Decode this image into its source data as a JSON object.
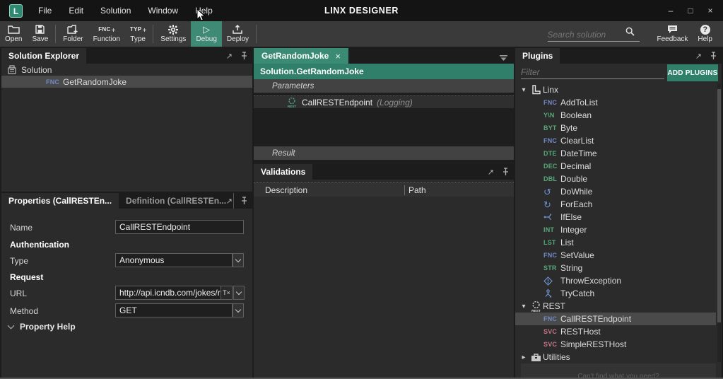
{
  "icons": {
    "caret_down": "▾",
    "caret_right": "▸",
    "popout": "↗",
    "close": "×",
    "minimize": "–",
    "maximize": "□",
    "play": "▷",
    "plus": "+",
    "loop_ccw": "↺",
    "loop_cw": "↻"
  },
  "colors": {
    "accent_teal": "#2f8069",
    "tab_teal": "#3b8a74",
    "badge_blue": "#7189c7",
    "badge_green": "#57a878",
    "badge_pink": "#c57487",
    "icon_blue": "#6b92cf"
  },
  "titlebar": {
    "logo_letter": "L",
    "app_title": "LINX DESIGNER",
    "menus": [
      {
        "label": "File"
      },
      {
        "label": "Edit"
      },
      {
        "label": "Solution"
      },
      {
        "label": "Window"
      },
      {
        "label": "Help"
      }
    ]
  },
  "toolbar": {
    "buttons": [
      {
        "label": "Open"
      },
      {
        "label": "Save"
      },
      {
        "label": "Folder"
      },
      {
        "label": "Function",
        "icon_text": "FNC"
      },
      {
        "label": "Type",
        "icon_text": "TYP"
      },
      {
        "label": "Settings"
      },
      {
        "label": "Debug"
      },
      {
        "label": "Deploy"
      }
    ],
    "search_placeholder": "Search solution",
    "feedback_label": "Feedback",
    "help_label": "Help"
  },
  "solution_explorer": {
    "title": "Solution Explorer",
    "root_label": "Solution",
    "items": [
      {
        "badge": "FNC",
        "label": "GetRandomJoke"
      }
    ]
  },
  "properties": {
    "tab_properties": "Properties (CallRESTEn...",
    "tab_definition": "Definition (CallRESTEn...",
    "name_label": "Name",
    "name_value": "CallRESTEndpoint",
    "auth_section": "Authentication",
    "type_label": "Type",
    "type_value": "Anonymous",
    "request_section": "Request",
    "url_label": "URL",
    "url_value": "http://api.icndb.com/jokes/ran",
    "url_clear": "T×",
    "method_label": "Method",
    "method_value": "GET",
    "property_help_label": "Property Help"
  },
  "editor": {
    "tab_label": "GetRandomJoke",
    "breadcrumb": "Solution.GetRandomJoke",
    "parameters_label": "Parameters",
    "function_name": "CallRESTEndpoint",
    "function_suffix": "(Logging)",
    "function_icon_text": "REST",
    "result_label": "Result"
  },
  "validations": {
    "title": "Validations",
    "columns": [
      {
        "label": "Description"
      },
      {
        "label": "Path"
      }
    ]
  },
  "plugins": {
    "title": "Plugins",
    "filter_placeholder": "Filter",
    "add_button": "ADD PLUGINS",
    "footer": "Can't find what you need?",
    "rest_icon_text": "REST",
    "tree": [
      {
        "type": "group",
        "label": "Linx",
        "expanded": true
      },
      {
        "type": "item",
        "badge": "FNC",
        "badge_color": "blue",
        "label": "AddToList"
      },
      {
        "type": "item",
        "badge": "Y\\N",
        "badge_color": "green",
        "label": "Boolean"
      },
      {
        "type": "item",
        "badge": "BYT",
        "badge_color": "green",
        "label": "Byte"
      },
      {
        "type": "item",
        "badge": "FNC",
        "badge_color": "blue",
        "label": "ClearList"
      },
      {
        "type": "item",
        "badge": "DTE",
        "badge_color": "green",
        "label": "DateTime"
      },
      {
        "type": "item",
        "badge": "DEC",
        "badge_color": "green",
        "label": "Decimal"
      },
      {
        "type": "item",
        "badge": "DBL",
        "badge_color": "green",
        "label": "Double"
      },
      {
        "type": "item",
        "icon": "dowhile",
        "label": "DoWhile"
      },
      {
        "type": "item",
        "icon": "foreach",
        "label": "ForEach"
      },
      {
        "type": "item",
        "icon": "ifelse",
        "label": "IfElse"
      },
      {
        "type": "item",
        "badge": "INT",
        "badge_color": "green",
        "label": "Integer"
      },
      {
        "type": "item",
        "badge": "LST",
        "badge_color": "green",
        "label": "List"
      },
      {
        "type": "item",
        "badge": "FNC",
        "badge_color": "blue",
        "label": "SetValue"
      },
      {
        "type": "item",
        "badge": "STR",
        "badge_color": "green",
        "label": "String"
      },
      {
        "type": "item",
        "icon": "throwexception",
        "label": "ThrowException"
      },
      {
        "type": "item",
        "icon": "trycatch",
        "label": "TryCatch"
      },
      {
        "type": "group",
        "label": "REST",
        "expanded": true
      },
      {
        "type": "item",
        "badge": "FNC",
        "badge_color": "blue",
        "label": "CallRESTEndpoint",
        "selected": true
      },
      {
        "type": "item",
        "badge": "SVC",
        "badge_color": "pink",
        "label": "RESTHost"
      },
      {
        "type": "item",
        "badge": "SVC",
        "badge_color": "pink",
        "label": "SimpleRESTHost"
      },
      {
        "type": "group",
        "label": "Utilities",
        "expanded": false
      }
    ]
  }
}
